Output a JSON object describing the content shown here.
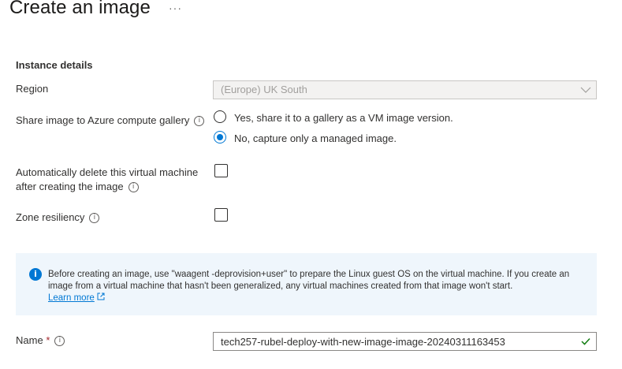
{
  "header": {
    "title": "Create an image",
    "more": "···"
  },
  "section": {
    "title": "Instance details"
  },
  "region": {
    "label": "Region",
    "value": "(Europe) UK South"
  },
  "share": {
    "label": "Share image to Azure compute gallery",
    "options": [
      {
        "label": "Yes, share it to a gallery as a VM image version.",
        "selected": false
      },
      {
        "label": "No, capture only a managed image.",
        "selected": true
      }
    ]
  },
  "auto_delete": {
    "label_line1": "Automatically delete this virtual machine",
    "label_line2": "after creating the image",
    "checked": false
  },
  "zone": {
    "label": "Zone resiliency",
    "checked": false
  },
  "info": {
    "text": "Before creating an image, use \"waagent -deprovision+user\" to prepare the Linux guest OS on the virtual machine. If you create an image from a virtual machine that hasn't been generalized, any virtual machines created from that image won't start.",
    "link": "Learn more"
  },
  "name": {
    "label": "Name",
    "required_mark": "*",
    "value": "tech257-rubel-deploy-with-new-image-image-20240311163453"
  },
  "colors": {
    "accent": "#0078d4",
    "valid": "#107c10",
    "required": "#a4262c"
  }
}
